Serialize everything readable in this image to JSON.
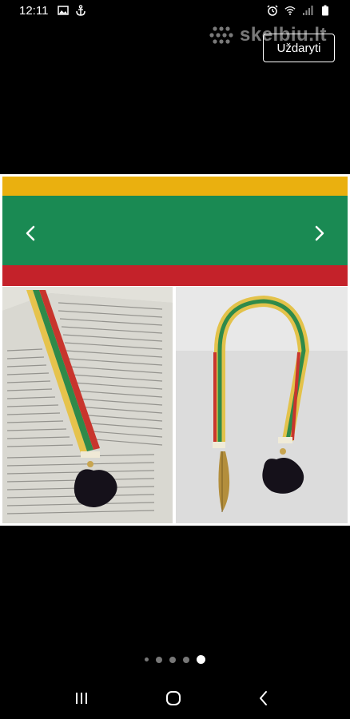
{
  "status_bar": {
    "time": "12:11",
    "left_icons": [
      "image-icon",
      "anchor-icon"
    ],
    "right_icons": [
      "alarm-icon",
      "wifi-icon",
      "signal-icon",
      "battery-icon"
    ]
  },
  "watermark": {
    "text": "skelbiu.lt"
  },
  "close_button": {
    "label": "Uždaryti"
  },
  "flag": {
    "colors": [
      "#eab00f",
      "#1a8a53",
      "#c4222a"
    ]
  },
  "gallery": {
    "photos": [
      "bookmark-on-open-book-photo",
      "bookmark-on-table-photo"
    ]
  },
  "carousel": {
    "dot_count": 5,
    "active_index": 4
  },
  "nav_bar": {
    "buttons": [
      "recents-icon",
      "home-icon",
      "back-icon"
    ]
  }
}
